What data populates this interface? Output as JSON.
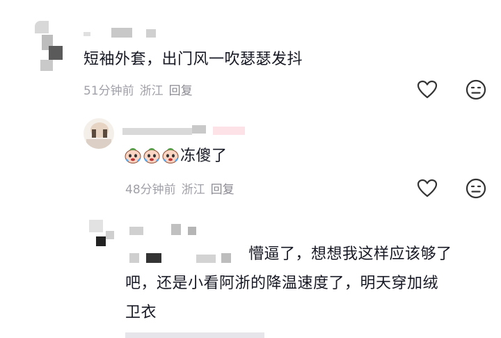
{
  "comments": [
    {
      "text": "短袖外套，出门风一吹瑟瑟发抖",
      "meta": {
        "time": "51分钟前",
        "location": "浙江",
        "reply_label": "回复"
      }
    },
    {
      "emoji_icon": "crying-face-emoji",
      "emoji_count": 3,
      "text": "冻傻了",
      "meta": {
        "time": "48分钟前",
        "location": "浙江",
        "reply_label": "回复"
      }
    },
    {
      "text_lines": [
        "懵逼了，想想我这样应该够了",
        "吧，还是小看阿浙的降温速度了，明天穿加绒",
        "卫衣"
      ]
    }
  ],
  "icons": {
    "like": "heart-icon",
    "dislike": "frown-face-icon"
  },
  "colors": {
    "text": "#161823",
    "meta": "#a0a0a8",
    "icon": "#333333"
  }
}
